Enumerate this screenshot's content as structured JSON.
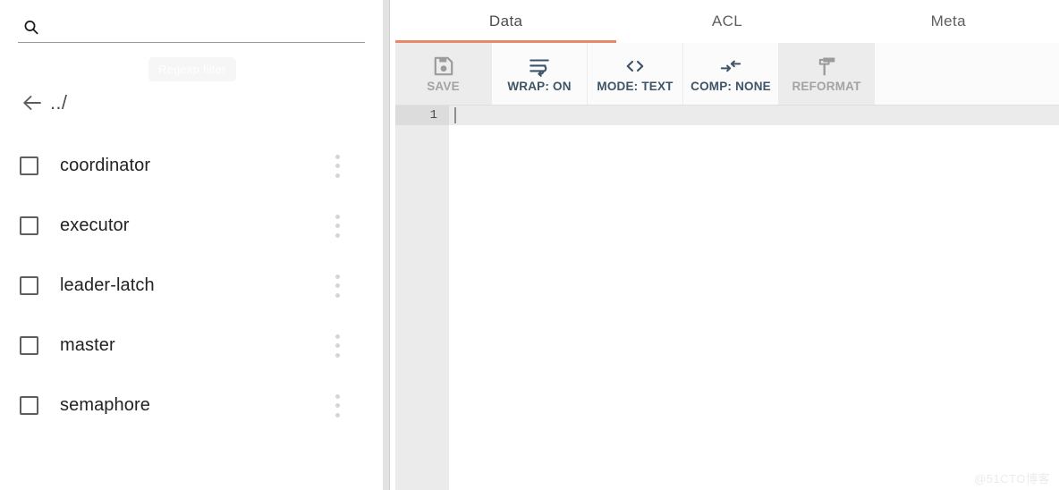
{
  "sidebar": {
    "search": {
      "icon": "search-icon",
      "value": "",
      "placeholder": ""
    },
    "tooltip": {
      "label": "Regexp filter"
    },
    "updir": {
      "icon": "arrow-left-icon",
      "label": "../"
    },
    "nodes": [
      {
        "label": "coordinator",
        "checked": false,
        "menu_icon": "kebab-menu-icon"
      },
      {
        "label": "executor",
        "checked": false,
        "menu_icon": "kebab-menu-icon"
      },
      {
        "label": "leader-latch",
        "checked": false,
        "menu_icon": "kebab-menu-icon"
      },
      {
        "label": "master",
        "checked": false,
        "menu_icon": "kebab-menu-icon"
      },
      {
        "label": "semaphore",
        "checked": false,
        "menu_icon": "kebab-menu-icon"
      }
    ]
  },
  "main": {
    "tabs": [
      {
        "label": "Data",
        "active": true
      },
      {
        "label": "ACL",
        "active": false
      },
      {
        "label": "Meta",
        "active": false
      }
    ],
    "toolbar": [
      {
        "label": "SAVE",
        "icon": "floppy-disk-icon",
        "disabled": true
      },
      {
        "label": "WRAP: ON",
        "icon": "text-wrap-icon",
        "disabled": false
      },
      {
        "label": "MODE: TEXT",
        "icon": "code-brackets-icon",
        "disabled": false
      },
      {
        "label": "COMP: NONE",
        "icon": "compress-icon",
        "disabled": false
      },
      {
        "label": "REFORMAT",
        "icon": "paint-roller-icon",
        "disabled": true
      }
    ],
    "editor": {
      "line_numbers": [
        "1"
      ],
      "content": ""
    }
  },
  "watermark": {
    "text": "@51CTO博客"
  },
  "colors": {
    "accent": "#e8886a",
    "toolbar_enabled_text": "#3f5468",
    "toolbar_disabled_text": "#a3a3a3",
    "toolbar_disabled_bg": "#ececec",
    "gutter_bg": "#ebebeb",
    "active_line_bg": "#ebebeb"
  }
}
